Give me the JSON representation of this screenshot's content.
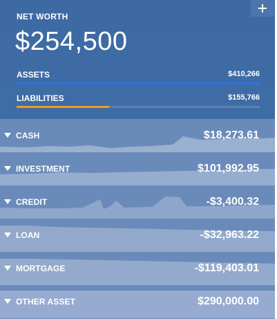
{
  "header": {
    "networth_label": "NET WORTH",
    "networth_value": "$254,500",
    "add_icon": "plus-icon",
    "assets": {
      "label": "ASSETS",
      "value": "$410,266",
      "bar_fill_percent": 100,
      "bar_color": "#2f73e6"
    },
    "liabilities": {
      "label": "LIABILITIES",
      "value": "$155,766",
      "bar_fill_percent": 38,
      "bar_color": "#f39b1f"
    }
  },
  "accounts": [
    {
      "name": "CASH",
      "value": "$18,273.61"
    },
    {
      "name": "INVESTMENT",
      "value": "$101,992.95"
    },
    {
      "name": "CREDIT",
      "value": "-$3,400.32"
    },
    {
      "name": "LOAN",
      "value": "-$32,963.22"
    },
    {
      "name": "MORTGAGE",
      "value": "-$119,403.01"
    },
    {
      "name": "OTHER ASSET",
      "value": "$290,000.00"
    }
  ],
  "theme": {
    "header_bg": "#3d6aa3",
    "accounts_bg": "#6e8fbd",
    "chart_fill": "#95aac9",
    "chart_fill_dark": "#86a0c6",
    "text": "#ffffff"
  }
}
